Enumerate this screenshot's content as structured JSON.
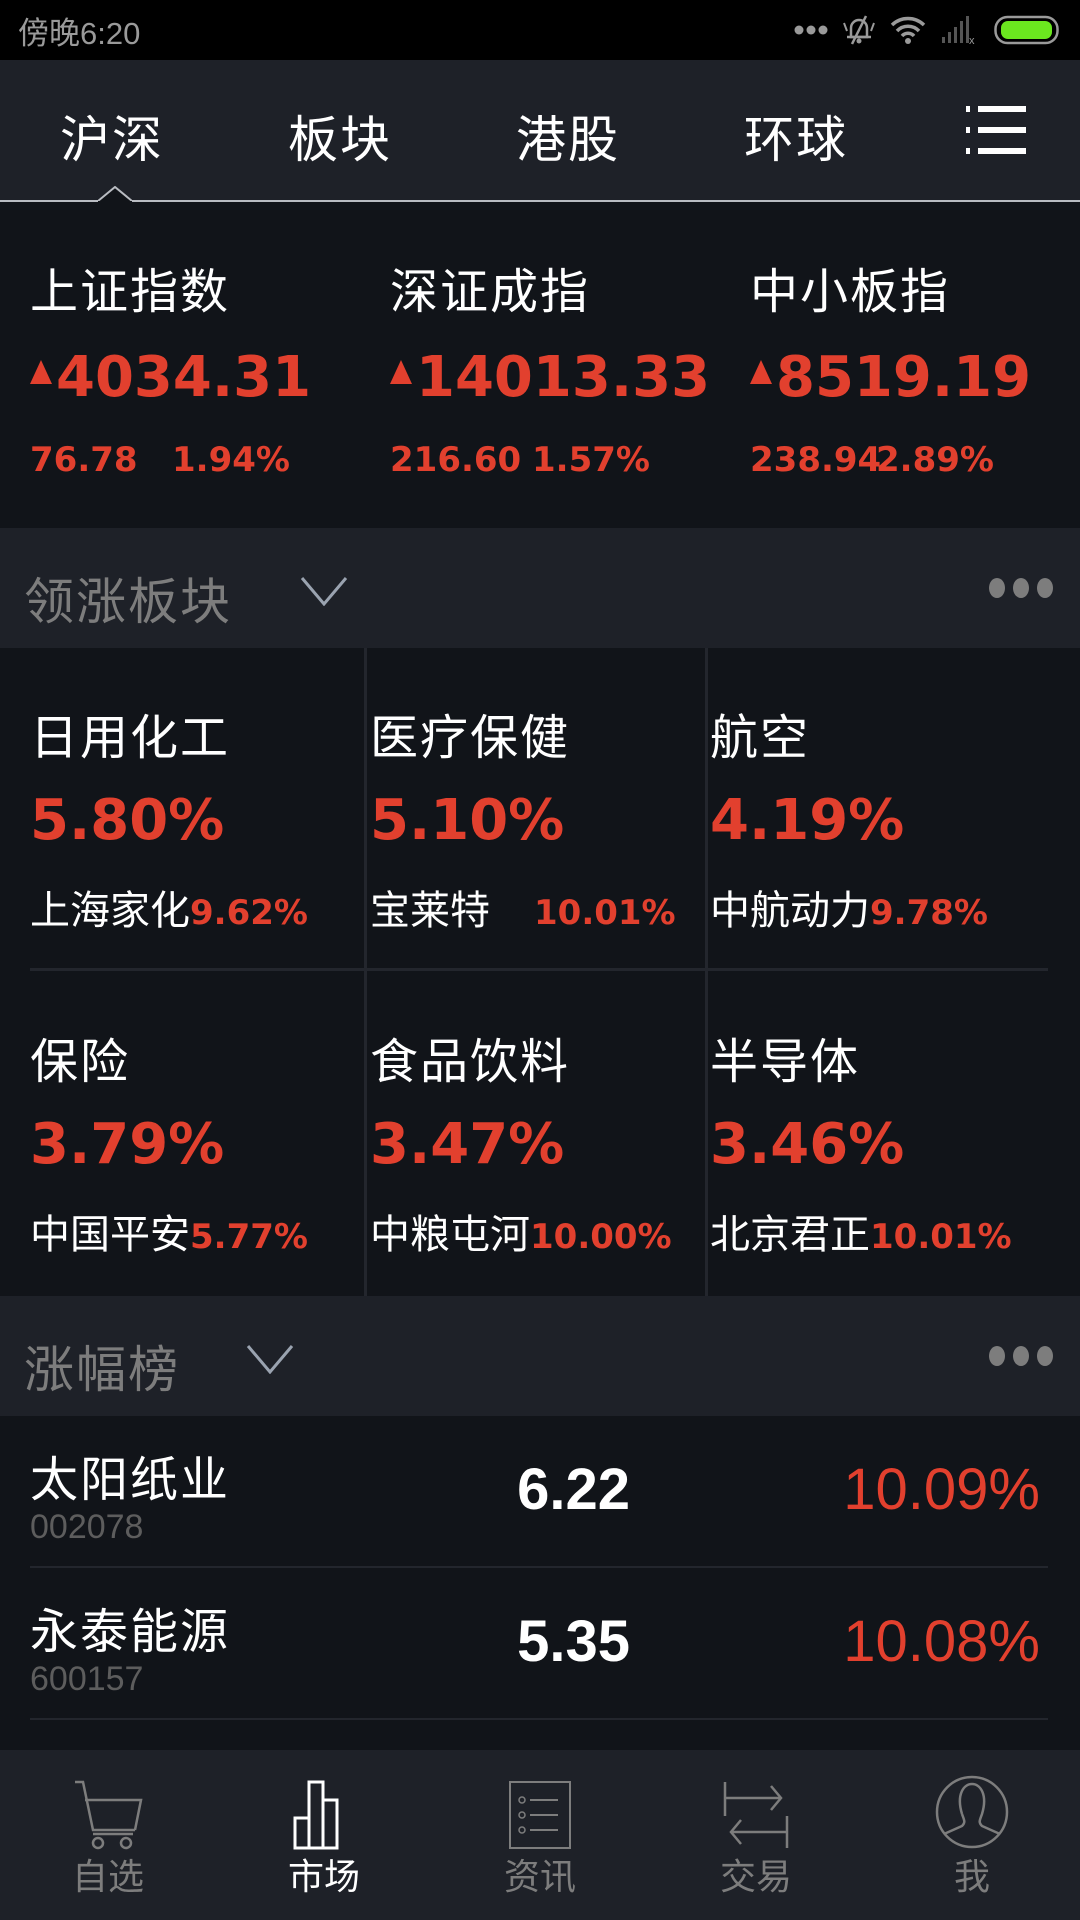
{
  "status_bar": {
    "time": "傍晚6:20",
    "icons": [
      "more-dots-icon",
      "bell-muted-icon",
      "wifi-icon",
      "signal-icon",
      "battery-icon"
    ],
    "battery_color": "#6be71f"
  },
  "top_tabs": {
    "items": [
      {
        "label": "沪深",
        "active": true
      },
      {
        "label": "板块",
        "active": false
      },
      {
        "label": "港股",
        "active": false
      },
      {
        "label": "环球",
        "active": false
      }
    ],
    "menu_icon": "list-menu-icon"
  },
  "indices": [
    {
      "name": "上证指数",
      "value": "4034.31",
      "change": "76.78",
      "change_pct": "1.94%",
      "direction": "up"
    },
    {
      "name": "深证成指",
      "value": "14013.33",
      "change": "216.60",
      "change_pct": "1.57%",
      "direction": "up"
    },
    {
      "name": "中小板指",
      "value": "8519.19",
      "change": "238.94",
      "change_pct": "2.89%",
      "direction": "up"
    }
  ],
  "sectors_section": {
    "title": "领涨板块",
    "more_icon": "more-dots-icon",
    "items": [
      {
        "name": "日用化工",
        "pct": "5.80%",
        "leader": "上海家化",
        "leader_pct": "9.62%"
      },
      {
        "name": "医疗保健",
        "pct": "5.10%",
        "leader": "宝莱特",
        "leader_pct": "10.01%"
      },
      {
        "name": "航空",
        "pct": "4.19%",
        "leader": "中航动力",
        "leader_pct": "9.78%"
      },
      {
        "name": "保险",
        "pct": "3.79%",
        "leader": "中国平安",
        "leader_pct": "5.77%"
      },
      {
        "name": "食品饮料",
        "pct": "3.47%",
        "leader": "中粮屯河",
        "leader_pct": "10.00%"
      },
      {
        "name": "半导体",
        "pct": "3.46%",
        "leader": "北京君正",
        "leader_pct": "10.01%"
      }
    ]
  },
  "gainers_section": {
    "title": "涨幅榜",
    "more_icon": "more-dots-icon",
    "rows": [
      {
        "name": "太阳纸业",
        "code": "002078",
        "price": "6.22",
        "change_pct": "10.09%"
      },
      {
        "name": "永泰能源",
        "code": "600157",
        "price": "5.35",
        "change_pct": "10.08%"
      }
    ]
  },
  "bottom_nav": {
    "items": [
      {
        "label": "自选",
        "icon": "cart-icon",
        "active": false
      },
      {
        "label": "市场",
        "icon": "bar-chart-icon",
        "active": true
      },
      {
        "label": "资讯",
        "icon": "news-list-icon",
        "active": false
      },
      {
        "label": "交易",
        "icon": "transfer-arrows-icon",
        "active": false
      },
      {
        "label": "我",
        "icon": "user-profile-icon",
        "active": false
      }
    ]
  },
  "colors": {
    "up_red": "#e2402e",
    "header_bg": "#1e2128",
    "content_bg": "#111419",
    "muted_text": "#7d7d7d"
  }
}
